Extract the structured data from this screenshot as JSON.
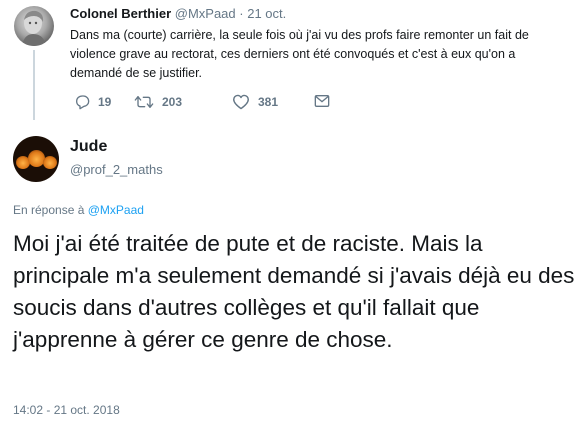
{
  "parent_tweet": {
    "name": "Colonel Berthier",
    "handle": "@MxPaad",
    "separator": "·",
    "date": "21 oct.",
    "text": "Dans ma (courte) carrière, la seule fois où j'ai vu des profs faire remonter un fait de violence grave au rectorat, ces derniers ont été convoqués et c'est à eux qu'on a demandé de se justifier.",
    "actions": {
      "reply_count": "19",
      "retweet_count": "203",
      "like_count": "381"
    }
  },
  "main_tweet": {
    "name": "Jude",
    "handle": "@prof_2_maths",
    "reply_prefix": "En réponse à",
    "reply_mention": "@MxPaad",
    "text": "Moi j'ai été traitée de pute et de raciste. Mais la principale m'a seulement demandé si j'avais déjà eu des soucis dans d'autres collèges et qu'il fallait que j'apprenne à gérer ce genre de chose.",
    "timestamp": "14:02 - 21 oct. 2018"
  },
  "colors": {
    "text": "#14171a",
    "secondary": "#657786",
    "link": "#1da1f2",
    "thread_line": "#ccd6dd"
  }
}
